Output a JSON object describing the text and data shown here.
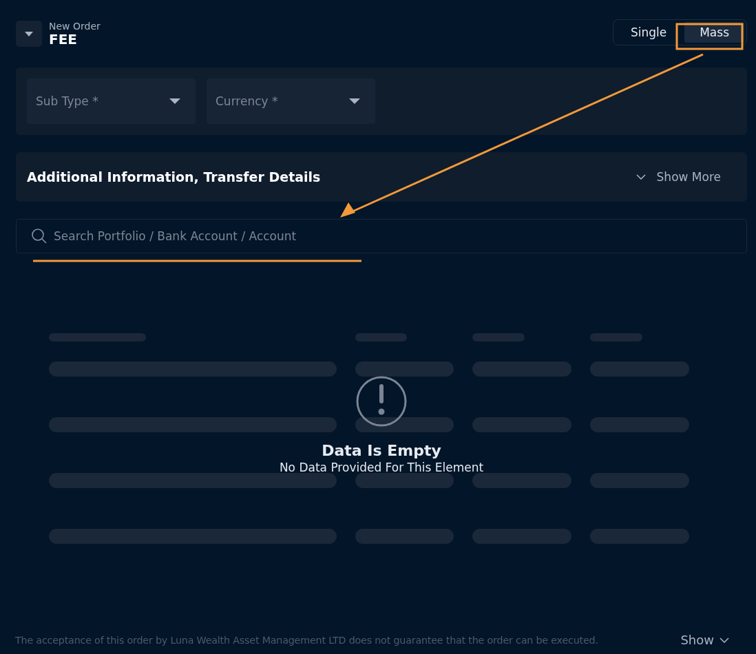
{
  "header": {
    "subtitle": "New Order",
    "title": "FEE"
  },
  "mode_tabs": [
    {
      "label": "Single",
      "selected": false
    },
    {
      "label": "Mass",
      "selected": true
    }
  ],
  "filters": [
    {
      "placeholder": "Sub Type *"
    },
    {
      "placeholder": "Currency *"
    }
  ],
  "info_section": {
    "title": "Additional Information, Transfer Details",
    "toggle": "Show More",
    "expanded": false
  },
  "search": {
    "placeholder": "Search Portfolio / Bank Account / Account"
  },
  "empty_state": {
    "title": "Data Is Empty",
    "message": "No Data Provided For This Element"
  },
  "footer": {
    "disclaimer": "The acceptance of this order by Luna Wealth Asset Management LTD does not guarantee that the order can be executed.",
    "toggle": "Show",
    "expanded": false
  }
}
